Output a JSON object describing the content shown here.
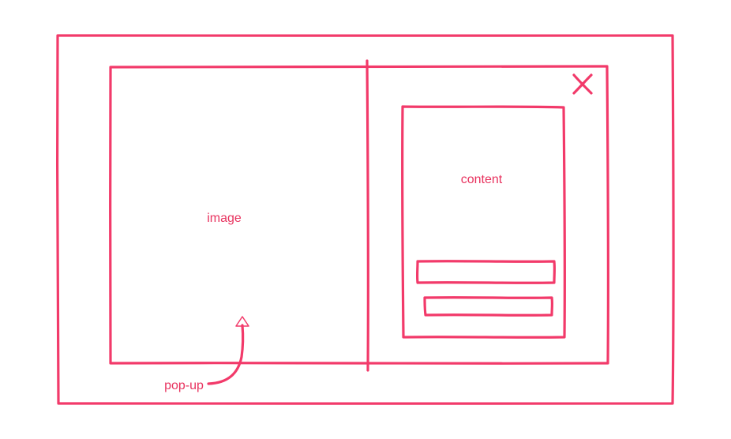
{
  "colors": {
    "stroke": "#f23a6a",
    "text": "#e8335f",
    "background": "#ffffff"
  },
  "labels": {
    "image": "image",
    "content": "content",
    "popup": "pop-up"
  },
  "icons": {
    "close": "close-icon",
    "arrow": "arrow-up-icon"
  }
}
